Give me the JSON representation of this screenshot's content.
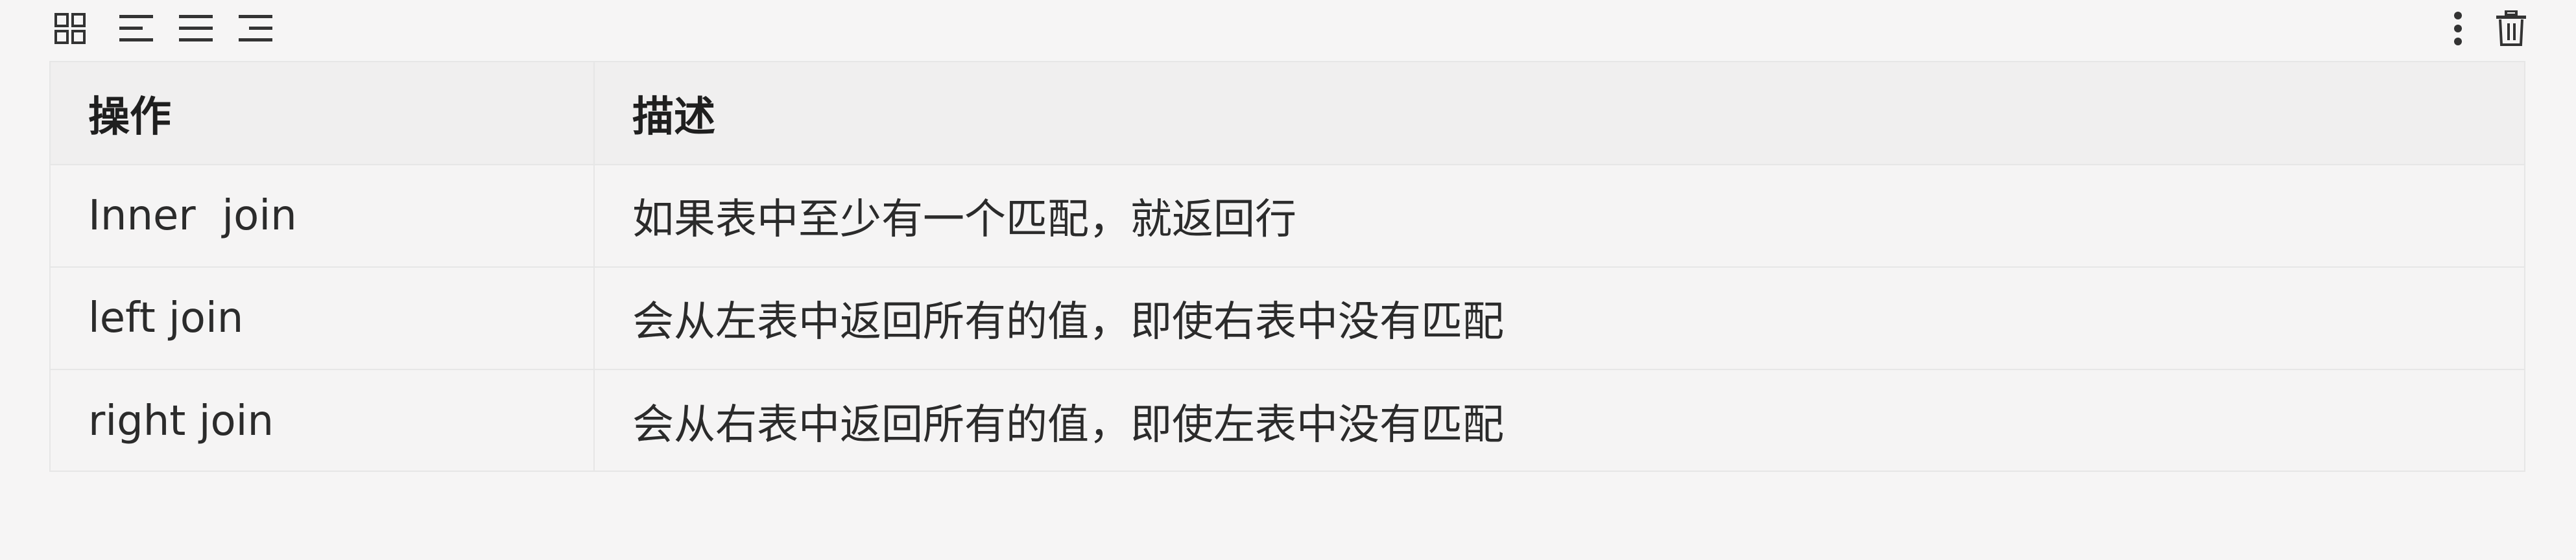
{
  "toolbar": {
    "left_icons": [
      "grid-icon",
      "align-left-icon",
      "align-center-icon",
      "align-right-icon"
    ],
    "right_icons": [
      "more-vertical-icon",
      "trash-icon"
    ]
  },
  "table": {
    "headers": [
      "操作",
      "描述"
    ],
    "rows": [
      {
        "op": "Inner  join",
        "desc": "如果表中至少有一个匹配，就返回行"
      },
      {
        "op": "left join",
        "desc": "会从左表中返回所有的值，即使右表中没有匹配"
      },
      {
        "op": "right join",
        "desc": "会从右表中返回所有的值，即使左表中没有匹配"
      }
    ]
  }
}
